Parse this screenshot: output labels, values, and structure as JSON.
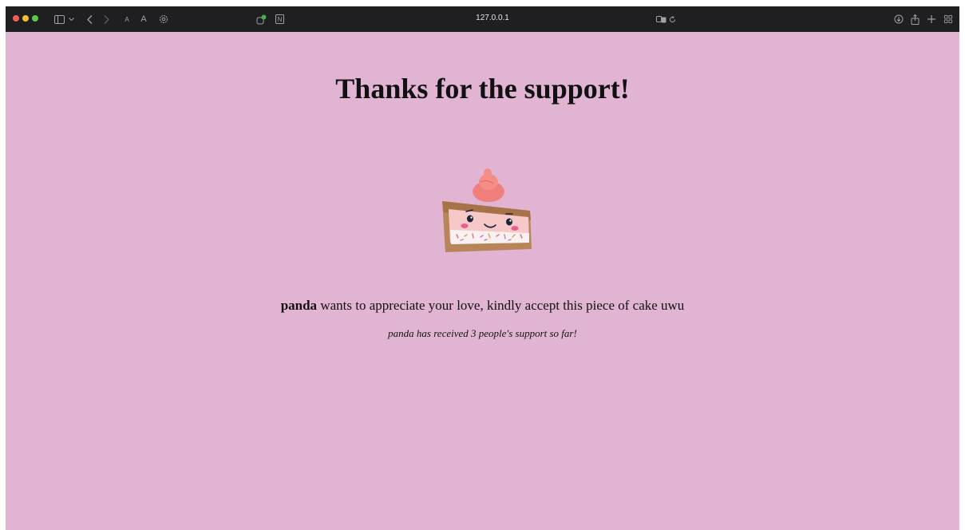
{
  "browser": {
    "url": "127.0.0.1",
    "colors": {
      "toolbar": "#1f1f21",
      "page_background": "#e1b4d4"
    },
    "icons": [
      "sidebar-icon",
      "chevron-down-icon",
      "back-icon",
      "forward-icon",
      "text-smaller-icon",
      "text-larger-icon",
      "settings-icon",
      "extension-icon",
      "notion-icon",
      "translate-icon",
      "reload-icon",
      "download-icon",
      "share-icon",
      "new-tab-icon",
      "tab-overview-icon"
    ]
  },
  "page": {
    "title": "Thanks for the support!",
    "supporter_name": "panda",
    "message_rest": " wants to appreciate your love, kindly accept this piece of cake uwu",
    "count_text": "panda has received 3 people's support so far!"
  }
}
